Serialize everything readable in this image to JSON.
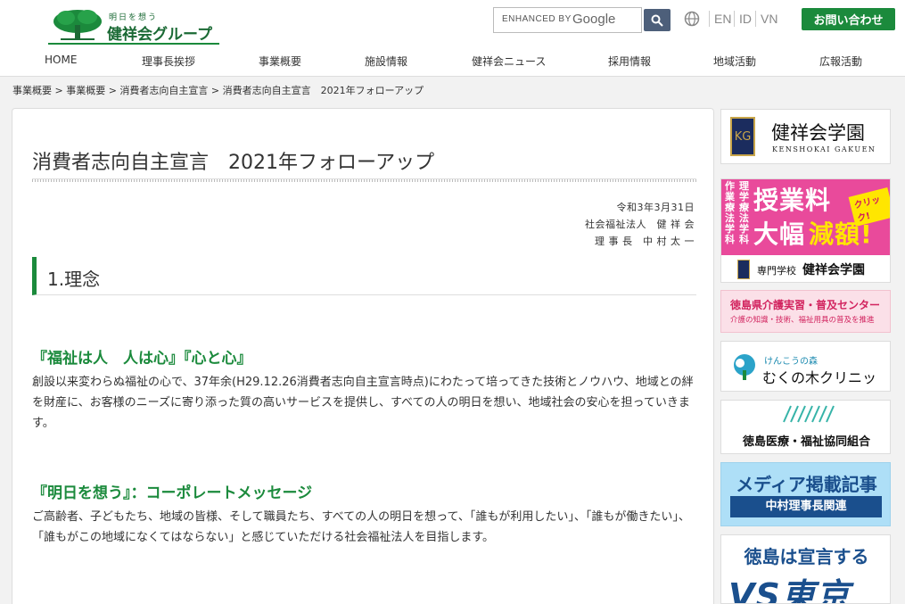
{
  "header": {
    "logo_tagline": "明日を想う",
    "logo_name": "健祥会グループ",
    "search_label": "ENHANCED BY",
    "search_brand": "Google",
    "langs": [
      "EN",
      "ID",
      "VN"
    ],
    "contact_label": "お問い合わせ"
  },
  "nav": [
    "HOME",
    "理事長挨拶",
    "事業概要",
    "施設情報",
    "健祥会ニュース",
    "採用情報",
    "地域活動",
    "広報活動"
  ],
  "breadcrumb": "事業概要 > 事業概要 > 消費者志向自主宣言 > 消費者志向自主宣言　2021年フォローアップ",
  "main": {
    "title": "消費者志向自主宣言　2021年フォローアップ",
    "date": "令和3年3月31日",
    "org": "社会福祉法人　健 祥 会",
    "signer": "理 事 長　中 村 太 一",
    "section1": "1.理念",
    "sub1": "『福祉は人　人は心』『心と心』",
    "para1": "創設以来変わらぬ福祉の心で、37年余(H29.12.26消費者志向自主宣言時点)にわたって培ってきた技術とノウハウ、地域との絆を財産に、お客様のニーズに寄り添った質の高いサービスを提供し、すべての人の明日を想い、地域社会の安心を担っていきます。",
    "sub2": "『明日を想う』：コーポレートメッセージ",
    "para2": "ご高齢者、子どもたち、地域の皆様、そして職員たち、すべての人の明日を想って、「誰もが利用したい」、「誰もが働きたい」、「誰もがこの地域になくてはならない」と感じていただける社会福祉法人を目指します。"
  },
  "sidebar": {
    "b1_emblem": "KG",
    "b1_jp": "健祥会学園",
    "b1_en": "KENSHOKAI GAKUEN",
    "b2_vert1": "作業療法学科",
    "b2_vert2": "理学療法学科",
    "b2_line1": "授業料",
    "b2_line2a": "大幅",
    "b2_line2b": "減額!",
    "b2_click": "クリック!",
    "b2_school_small": "専門学校",
    "b2_school": "健祥会学園",
    "b3_line1": "徳島県介護実習・普及センター",
    "b3_line2": "介護の知識・技術、福祉用具の普及を推進",
    "b4_small": "けんこうの森",
    "b4_big": "むくの木クリニック",
    "b5_text": "徳島医療・福祉協同組合",
    "b6_title": "メディア掲載記事",
    "b6_bar": "中村理事長関連",
    "b7_line1": "徳島は宣言する",
    "b7_line2": "VS東京"
  },
  "colors": {
    "brand_green": "#1b8a3c",
    "navy": "#1a4f8d",
    "pink": "#e94a9b"
  }
}
